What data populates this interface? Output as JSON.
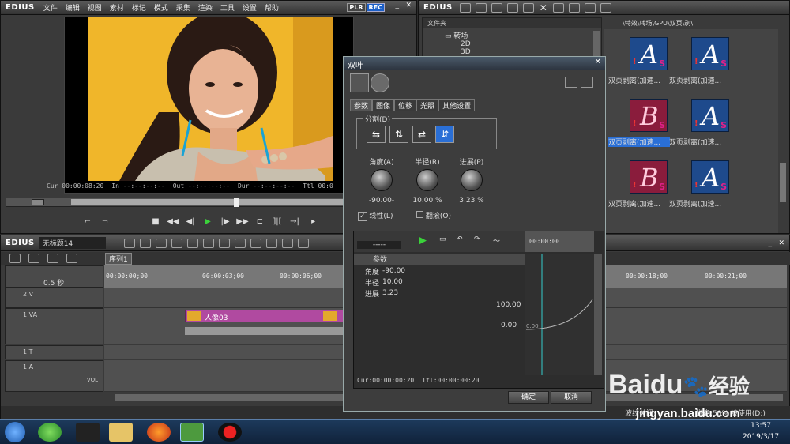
{
  "app": {
    "brand": "EDIUS",
    "menu": [
      "文件",
      "编辑",
      "视图",
      "素材",
      "标记",
      "模式",
      "采集",
      "渲染",
      "工具",
      "设置",
      "帮助"
    ],
    "plr": "PLR",
    "rec": "REC"
  },
  "player": {
    "cur_label": "Cur",
    "cur_val": "00:00:08:20",
    "in_label": "In",
    "in_val": "--:--:--:--",
    "out_label": "Out",
    "out_val": "--:--:--:--",
    "dur_label": "Dur",
    "dur_val": "--:--:--:--",
    "ttl_label": "Ttl",
    "ttl_val": "00:0"
  },
  "bin": {
    "brand": "EDIUS",
    "folder_header": "文件夹",
    "folder_root": "转场",
    "folder_2d": "2D",
    "folder_3d": "3D",
    "folder_3": "",
    "path": "\\特效\\转场\\GPU\\双页\\剥\\",
    "items": [
      {
        "letter": "A",
        "label": "双页剥离(加速..."
      },
      {
        "letter": "A",
        "label": "双页剥离(加速..."
      },
      {
        "letter": "B",
        "label": "双页剥离(加速..."
      },
      {
        "letter": "A",
        "label": "双页剥离(加速..."
      },
      {
        "letter": "B",
        "label": "双页剥离(加速..."
      },
      {
        "letter": "A",
        "label": "双页剥离(加速..."
      }
    ]
  },
  "timeline": {
    "brand": "EDIUS",
    "project": "无标题14",
    "sequence_tab": "序列1",
    "scale": "0.5 秒",
    "ruler": [
      "00:00:00;00",
      "00:00:03;00",
      "00:00:06;00",
      "00:00:18;00",
      "00:00:21;00"
    ],
    "tracks": [
      "2 V",
      "1 VA",
      "1 T",
      "1 A"
    ],
    "vol": "VOL",
    "clip": "人像03"
  },
  "dialog": {
    "title": "双叶",
    "tabs": [
      "参数",
      "图像",
      "位移",
      "光照",
      "其他设置"
    ],
    "split_group": "分割(D)",
    "knobs": [
      {
        "label": "角度(A)",
        "value": "-90.00-"
      },
      {
        "label": "半径(R)",
        "value": "10.00 %"
      },
      {
        "label": "进展(P)",
        "value": "3.23 %"
      }
    ],
    "linear": "线性(L)",
    "flip": "翻滚(O)",
    "combo": "-----",
    "params_group": "参数",
    "params": [
      {
        "name": "角度",
        "value": "-90.00"
      },
      {
        "name": "半径",
        "value": "10.00"
      },
      {
        "name": "进展",
        "value": "3.23"
      }
    ],
    "graph_max": "100.00",
    "graph_min": "0.00",
    "graph_zero": "0.00",
    "kf_time": "00:00:00",
    "cur": "Cur:00:00:00:20",
    "ttl": "Ttl:00:00:00:20",
    "ok": "确定",
    "cancel": "取消"
  },
  "status": {
    "ripple_off": "波纹关闭",
    "disk": "磁盘:58% 被使用(D:)"
  },
  "taskbar": {
    "time": "13:57",
    "date": "2019/3/17"
  },
  "watermark": {
    "baidu": "Baidu",
    "jingyan": "经验",
    "url": "jingyan.baidu.com"
  },
  "colors": {
    "accent": "#2a6fd6",
    "clip": "#b04aa0",
    "thumb": "#1e4a8c",
    "play": "#3ad23a"
  }
}
